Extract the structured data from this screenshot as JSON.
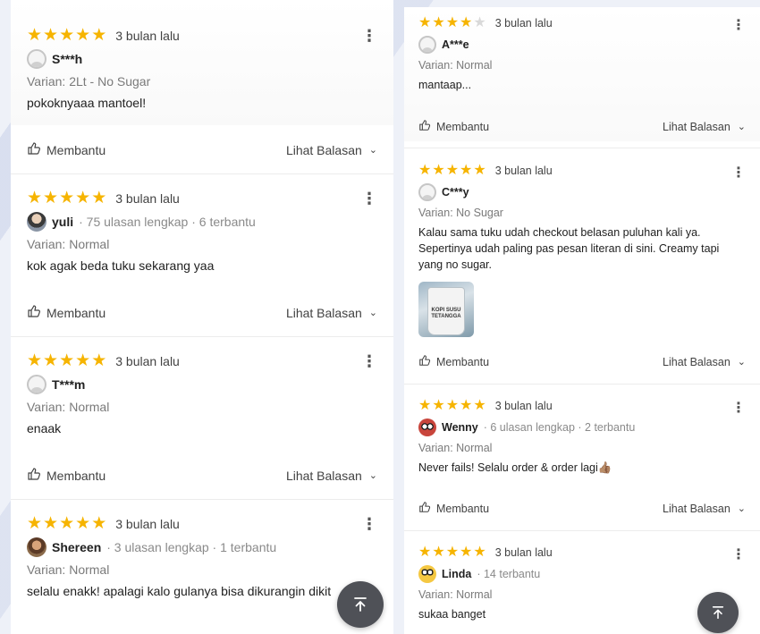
{
  "left_reviews": [
    {
      "stars": 5,
      "time": "3 bulan lalu",
      "name": "S***h",
      "meta": "",
      "varian": "Varian: 2Lt - No Sugar",
      "text": "pokoknyaaa mantoel!",
      "helpful": "Membantu",
      "reply": "Lihat Balasan",
      "avatar": "default-avatar"
    },
    {
      "stars": 5,
      "time": "3 bulan lalu",
      "name": "yuli",
      "meta": "· 75 ulasan lengkap · 6 terbantu",
      "varian": "Varian: Normal",
      "text": "kok agak beda tuku sekarang yaa",
      "helpful": "Membantu",
      "reply": "Lihat Balasan",
      "avatar": "photo-avatar"
    },
    {
      "stars": 5,
      "time": "3 bulan lalu",
      "name": "T***m",
      "meta": "",
      "varian": "Varian: Normal",
      "text": "enaak",
      "helpful": "Membantu",
      "reply": "Lihat Balasan",
      "avatar": "default-avatar"
    },
    {
      "stars": 5,
      "time": "3 bulan lalu",
      "name": "Shereen",
      "meta": "· 3 ulasan lengkap · 1 terbantu",
      "varian": "Varian: Normal",
      "text": "selalu enakk! apalagi kalo gulanya bisa dikurangin dikit",
      "helpful": "",
      "reply": "",
      "avatar": "photo-avatar"
    }
  ],
  "right_reviews": [
    {
      "stars": 4,
      "time": "3 bulan lalu",
      "name": "A***e",
      "meta": "",
      "varian": "Varian: Normal",
      "text": "mantaap...",
      "helpful": "Membantu",
      "reply": "Lihat Balasan",
      "avatar": "default-avatar"
    },
    {
      "stars": 5,
      "time": "3 bulan lalu",
      "name": "C***y",
      "meta": "",
      "varian": "Varian: No Sugar",
      "text": "Kalau sama tuku udah checkout belasan puluhan kali ya. Sepertinya udah paling pas pesan literan di sini. Creamy tapi yang no sugar.",
      "image_label": "KOPI SUSU TETANGGA",
      "helpful": "Membantu",
      "reply": "Lihat Balasan",
      "avatar": "default-avatar"
    },
    {
      "stars": 5,
      "time": "3 bulan lalu",
      "name": "Wenny",
      "meta": "· 6 ulasan lengkap · 2 terbantu",
      "varian": "Varian: Normal",
      "text": "Never fails! Selalu order & order lagi👍🏽",
      "helpful": "Membantu",
      "reply": "Lihat Balasan",
      "avatar": "emoji-avatar"
    },
    {
      "stars": 5,
      "time": "3 bulan lalu",
      "name": "Linda",
      "meta": "· 14 terbantu",
      "varian": "Varian: Normal",
      "text": "sukaa banget",
      "helpful": "",
      "reply": "",
      "avatar": "emoji-avatar"
    }
  ],
  "icons": {
    "star": "star-icon",
    "kebab": "kebab-menu-icon",
    "thumb": "thumbs-up-icon",
    "chevron": "chevron-down-icon",
    "scroll_top": "arrow-to-top-icon"
  },
  "colors": {
    "star": "#f6b400",
    "fab": "#4f5157"
  }
}
